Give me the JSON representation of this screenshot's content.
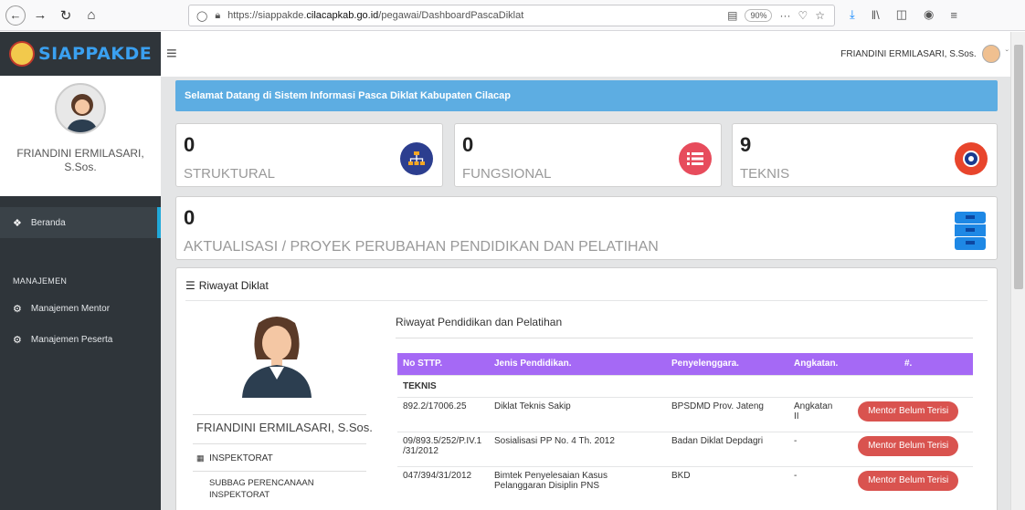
{
  "browser": {
    "url_prefix": "https://siappakde.",
    "url_domain": "cilacapkab.go.id",
    "url_path": "/pegawai/DashboardPascaDiklat",
    "zoom": "90%"
  },
  "app": {
    "logo_text": "SIAPPAKDE"
  },
  "sidebar": {
    "profile_name": "FRIANDINI ERMILASARI, S.Sos.",
    "home_label": "Beranda",
    "section_title": "MANAJEMEN",
    "items": [
      {
        "label": "Manajemen Mentor"
      },
      {
        "label": "Manajemen Peserta"
      }
    ]
  },
  "header": {
    "user_name": "FRIANDINI ERMILASARI, S.Sos."
  },
  "welcome_text": "Selamat Datang di Sistem Informasi Pasca Diklat Kabupaten Cilacap",
  "stats": [
    {
      "value": "0",
      "label": "STRUKTURAL",
      "color": "#2c3e8f",
      "icon": "sitemap-icon"
    },
    {
      "value": "0",
      "label": "FUNGSIONAL",
      "color": "#e74c5c",
      "icon": "list-icon"
    },
    {
      "value": "9",
      "label": "TEKNIS",
      "color": "#e8452c",
      "icon": "gear-icon"
    }
  ],
  "aktualisasi": {
    "value": "0",
    "label": "AKTUALISASI / PROYEK PERUBAHAN PENDIDIKAN DAN PELATIHAN"
  },
  "riwayat": {
    "title": "Riwayat Diklat",
    "person_name": "FRIANDINI ERMILASARI, S.Sos.",
    "org": "INSPEKTORAT",
    "sub_org": "SUBBAG PERENCANAAN INSPEKTORAT",
    "subtitle": "Riwayat Pendidikan dan Pelatihan",
    "columns": [
      "No STTP.",
      "Jenis Pendidikan.",
      "Penyelenggara.",
      "Angkatan.",
      "#."
    ],
    "group": "TEKNIS",
    "rows": [
      {
        "no": "892.2/17006.25",
        "jenis": "Diklat Teknis Sakip",
        "penyelenggara": "BPSDMD Prov. Jateng",
        "angkatan": "Angkatan II",
        "action": "Mentor Belum Terisi"
      },
      {
        "no": "09/893.5/252/P.IV.1 /31/2012",
        "jenis": "Sosialisasi PP No. 4 Th. 2012",
        "penyelenggara": "Badan Diklat Depdagri",
        "angkatan": "-",
        "action": "Mentor Belum Terisi"
      },
      {
        "no": "047/394/31/2012",
        "jenis": "Bimtek Penyelesaian Kasus Pelanggaran Disiplin PNS",
        "penyelenggara": "BKD",
        "angkatan": "-",
        "action": "Mentor Belum Terisi"
      }
    ]
  }
}
